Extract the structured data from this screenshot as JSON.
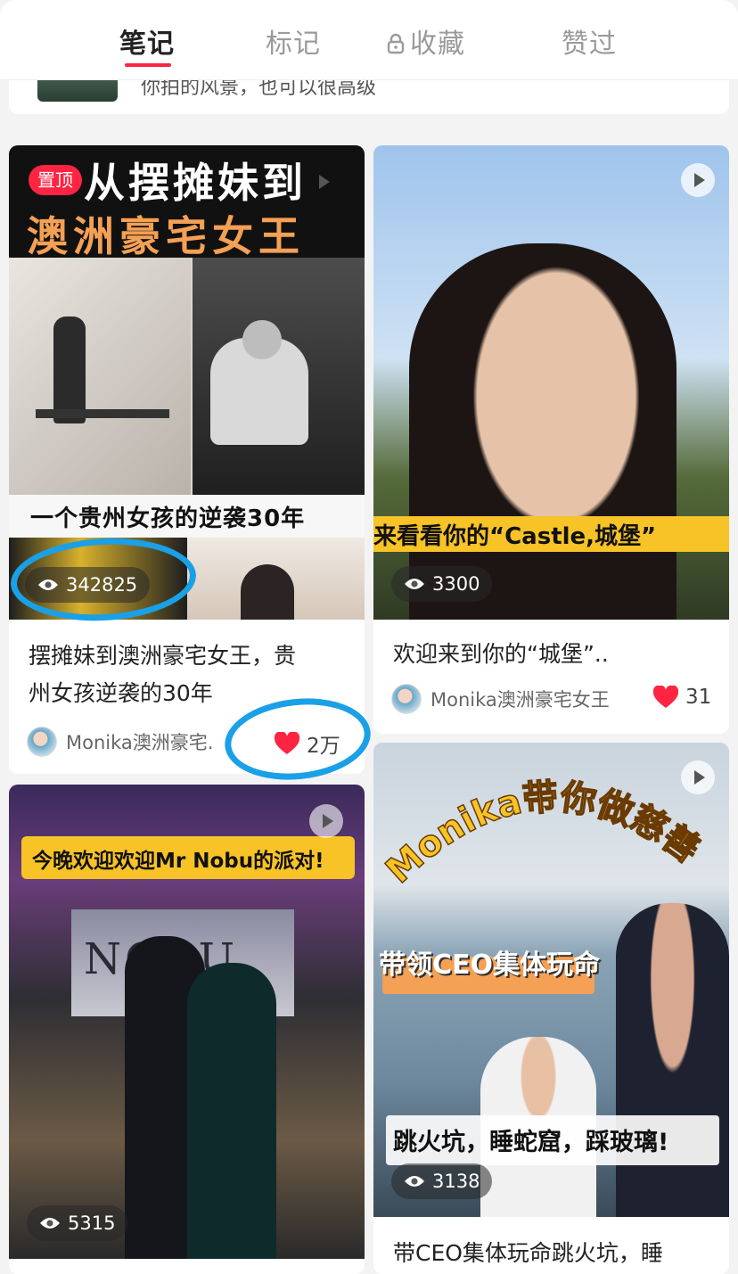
{
  "tabs": [
    {
      "label": "笔记",
      "active": true
    },
    {
      "label": "标记",
      "active": false
    },
    {
      "label": "收藏",
      "active": false,
      "icon": "lock-icon"
    },
    {
      "label": "赞过",
      "active": false
    }
  ],
  "partial_card": {
    "text": "你拍的风景，也可以很高级"
  },
  "colors": {
    "accent": "#ff2442",
    "annotation": "#1aa0e6",
    "banner_yellow": "#f7c326"
  },
  "cards": [
    {
      "pin_badge": "置顶",
      "overlay_top_1": "从摆摊妹到",
      "overlay_top_2": "澳洲豪宅女王",
      "overlay_mid": "一个贵州女孩的逆袭30年",
      "views": "342825",
      "title_line1": "摆摊妹到澳洲豪宅女王，贵",
      "title_line2": "州女孩逆袭的30年",
      "author": "Monika澳洲豪宅.",
      "likes": "2万"
    },
    {
      "overlay_banner": "来看看你的“Castle,城堡”",
      "views": "3300",
      "title": "欢迎来到你的“城堡”..",
      "author": "Monika澳洲豪宅女王",
      "likes": "31"
    },
    {
      "overlay_banner": "今晚欢迎欢迎Mr  Nobu的派对!",
      "sign_text": "NOBU",
      "views": "5315"
    },
    {
      "overlay_arc": "Monika带你做慈善",
      "overlay_mid": "带领CEO集体玩命",
      "overlay_bottom": "跳火坑，睡蛇窟，踩玻璃!",
      "views": "3138",
      "title": "带CEO集体玩命跳火坑，睡"
    }
  ]
}
